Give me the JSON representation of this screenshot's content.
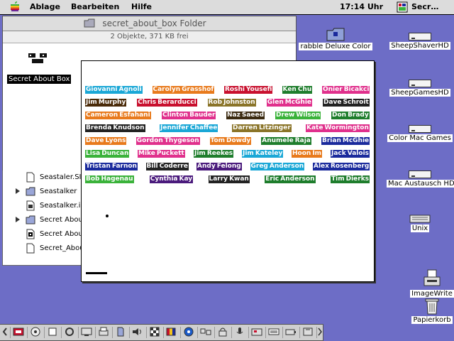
{
  "menubar": {
    "items": [
      "Ablage",
      "Bearbeiten",
      "Hilfe"
    ],
    "clock": "17:14 Uhr",
    "app_label": "Secr…"
  },
  "finder": {
    "title": "secret_about_box Folder",
    "info": "2 Objekte, 371 KB frei",
    "icon_label": "Secret About Box"
  },
  "list": {
    "rows": [
      {
        "label": "Seastaler.SIT",
        "triangle": false,
        "kind": "doc"
      },
      {
        "label": "Seastalker",
        "triangle": true,
        "kind": "folder"
      },
      {
        "label": "Seastalker.i",
        "triangle": false,
        "kind": "doc"
      },
      {
        "label": "Secret About",
        "triangle": true,
        "kind": "folder"
      },
      {
        "label": "Secret About",
        "triangle": false,
        "kind": "app"
      },
      {
        "label": "Secret_About",
        "triangle": false,
        "kind": "doc"
      }
    ]
  },
  "about": {
    "names": [
      [
        [
          "Giovanni",
          "Agnoli",
          "#1aa7d6"
        ],
        [
          "Carolyn",
          "Grasshof",
          "#e87a1c"
        ],
        [
          "Roshi",
          "Yousefi",
          "#c8102e"
        ],
        [
          "Ken",
          "Chu",
          "#1e7d2c"
        ],
        [
          "Onier",
          "Bicakci",
          "#e0308c"
        ]
      ],
      [
        [
          "Jim",
          "Murphy",
          "#4a2a08"
        ],
        [
          "Chris",
          "Berarducci",
          "#c8102e"
        ],
        [
          "Rob",
          "Johnston",
          "#8a7428"
        ],
        [
          "Glen",
          "McGhie",
          "#e0308c"
        ],
        [
          "Dave",
          "Schroit",
          "#222222"
        ]
      ],
      [
        [
          "Cameron",
          "Esfahani",
          "#e87a1c"
        ],
        [
          "Clinton",
          "Bauder",
          "#e0308c"
        ],
        [
          "Naz",
          "Saeed",
          "#3a2a10"
        ],
        [
          "Drew",
          "Wilson",
          "#3ab23a"
        ],
        [
          "Don",
          "Brady",
          "#1e7d2c"
        ]
      ],
      [
        [
          "Brenda",
          "Knudson",
          "#222222"
        ],
        [
          "Jennifer",
          "Chaffee",
          "#1aa7d6"
        ],
        [
          "Darren",
          "Litzinger",
          "#8a7428"
        ],
        [
          "Kate",
          "Wormington",
          "#e0308c"
        ]
      ],
      [
        [
          "Dave",
          "Lyons",
          "#e87a1c"
        ],
        [
          "Gordon",
          "Thygeson",
          "#e0308c"
        ],
        [
          "Tom",
          "Dowdy",
          "#e87a1c"
        ],
        [
          "Anumele",
          "Raja",
          "#1e7d2c"
        ],
        [
          "Brian",
          "McGhie",
          "#1a2a9c"
        ]
      ],
      [
        [
          "Lisa",
          "Duncan",
          "#3ab23a"
        ],
        [
          "Mike",
          "Puckett",
          "#e0308c"
        ],
        [
          "Jim",
          "Reekes",
          "#1e7d2c"
        ],
        [
          "Jim",
          "Kateley",
          "#1aa7d6"
        ],
        [
          "Hoon",
          "Im",
          "#e87a1c"
        ],
        [
          "Jack",
          "Valois",
          "#1a2a9c"
        ]
      ],
      [
        [
          "Tristan",
          "Farnon",
          "#1a2a9c"
        ],
        [
          "Bill",
          "Coderre",
          "#222222"
        ],
        [
          "Andy",
          "Felong",
          "#4a1a7c"
        ],
        [
          "Greg",
          "Anderson",
          "#1aa7d6"
        ],
        [
          "Alex",
          "Rosenberg",
          "#1a2a9c"
        ]
      ],
      [
        [
          "Bob",
          "Hagenau",
          "#3ab23a"
        ],
        [
          "Cynthia",
          "Kay",
          "#4a1a7c"
        ],
        [
          "Larry",
          "Kwan",
          "#222222"
        ],
        [
          "Eric",
          "Anderson",
          "#1e7d2c"
        ],
        [
          "Tim",
          "Dierks",
          "#1e7d2c"
        ]
      ]
    ]
  },
  "desktop": {
    "icons": [
      {
        "label": "rabble Deluxe Color",
        "kind": "app"
      },
      {
        "label": "SheepShaverHD",
        "kind": "drive"
      },
      {
        "label": "SheepGamesHD",
        "kind": "drive"
      },
      {
        "label": "Color Mac Games",
        "kind": "drive"
      },
      {
        "label": "Mac Austausch HD",
        "kind": "drive"
      },
      {
        "label": "Unix",
        "kind": "disk"
      },
      {
        "label": "ImageWrite",
        "kind": "printer"
      },
      {
        "label": "Papierkorb",
        "kind": "trash"
      }
    ]
  },
  "colors": {
    "desktop": "#6d6dc6",
    "menubar": "#dcdcdc"
  }
}
